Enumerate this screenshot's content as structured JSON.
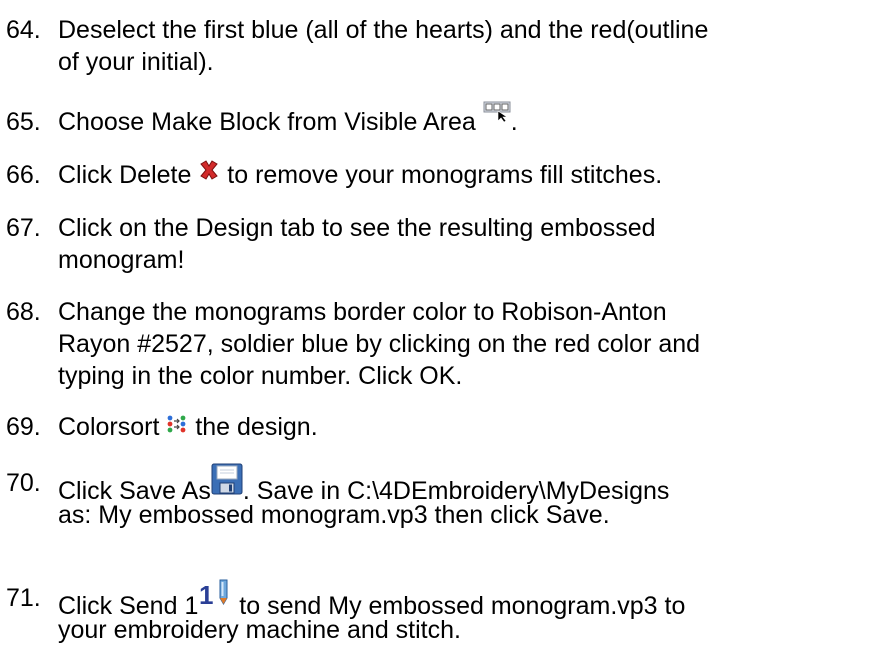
{
  "steps": [
    {
      "number": "64.",
      "lines": [
        "Deselect the first blue (all of the hearts) and the red(outline",
        "of your initial)."
      ]
    },
    {
      "number": "65.",
      "before": "Choose Make Block from Visible Area ",
      "icon": "make-block-icon",
      "after": "."
    },
    {
      "number": "66.",
      "before": "Click Delete ",
      "icon": "delete-x-icon",
      "after": " to remove your monograms fill stitches."
    },
    {
      "number": "67.",
      "lines": [
        "Click on the Design tab to see the resulting embossed",
        "monogram!"
      ]
    },
    {
      "number": "68.",
      "lines": [
        "Change the monograms border color to Robison-Anton",
        "Rayon #2527, soldier blue by clicking on the red color and",
        "typing in the color number.  Click OK."
      ]
    },
    {
      "number": "69.",
      "before": "Colorsort ",
      "icon": "colorsort-icon",
      "after": " the design."
    },
    {
      "number": "70.",
      "before": "Click Save As",
      "icon": "save-floppy-icon",
      "after": ".  Save in C:\\4DEmbroidery\\MyDesigns",
      "line2": "as: My embossed monogram.vp3 then click Save."
    },
    {
      "number": "71.",
      "before": "Click Send 1",
      "icon": "send-1-icon",
      "after": " to send My embossed monogram.vp3 to",
      "line2": "your embroidery machine and stitch."
    }
  ]
}
